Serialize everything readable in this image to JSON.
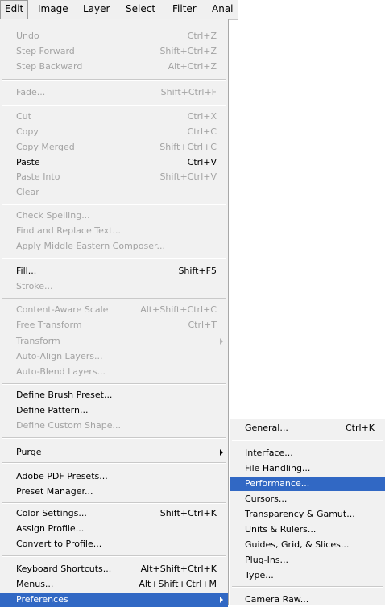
{
  "menubar": {
    "items": [
      "Edit",
      "Image",
      "Layer",
      "Select",
      "Filter",
      "Anal"
    ]
  },
  "edit_menu": {
    "undo": {
      "label": "Undo",
      "shortcut": "Ctrl+Z"
    },
    "step_forward": {
      "label": "Step Forward",
      "shortcut": "Shift+Ctrl+Z"
    },
    "step_backward": {
      "label": "Step Backward",
      "shortcut": "Alt+Ctrl+Z"
    },
    "fade": {
      "label": "Fade...",
      "shortcut": "Shift+Ctrl+F"
    },
    "cut": {
      "label": "Cut",
      "shortcut": "Ctrl+X"
    },
    "copy": {
      "label": "Copy",
      "shortcut": "Ctrl+C"
    },
    "copy_merged": {
      "label": "Copy Merged",
      "shortcut": "Shift+Ctrl+C"
    },
    "paste": {
      "label": "Paste",
      "shortcut": "Ctrl+V"
    },
    "paste_into": {
      "label": "Paste Into",
      "shortcut": "Shift+Ctrl+V"
    },
    "clear": {
      "label": "Clear"
    },
    "check_spelling": {
      "label": "Check Spelling..."
    },
    "find_replace": {
      "label": "Find and Replace Text..."
    },
    "apply_middle_eastern": {
      "label": "Apply Middle Eastern Composer..."
    },
    "fill": {
      "label": "Fill...",
      "shortcut": "Shift+F5"
    },
    "stroke": {
      "label": "Stroke..."
    },
    "content_aware_scale": {
      "label": "Content-Aware Scale",
      "shortcut": "Alt+Shift+Ctrl+C"
    },
    "free_transform": {
      "label": "Free Transform",
      "shortcut": "Ctrl+T"
    },
    "transform": {
      "label": "Transform"
    },
    "auto_align": {
      "label": "Auto-Align Layers..."
    },
    "auto_blend": {
      "label": "Auto-Blend Layers..."
    },
    "define_brush": {
      "label": "Define Brush Preset..."
    },
    "define_pattern": {
      "label": "Define Pattern..."
    },
    "define_shape": {
      "label": "Define Custom Shape..."
    },
    "purge": {
      "label": "Purge"
    },
    "adobe_pdf_presets": {
      "label": "Adobe PDF Presets..."
    },
    "preset_manager": {
      "label": "Preset Manager..."
    },
    "color_settings": {
      "label": "Color Settings...",
      "shortcut": "Shift+Ctrl+K"
    },
    "assign_profile": {
      "label": "Assign Profile..."
    },
    "convert_profile": {
      "label": "Convert to Profile..."
    },
    "keyboard_shortcuts": {
      "label": "Keyboard Shortcuts...",
      "shortcut": "Alt+Shift+Ctrl+K"
    },
    "menus": {
      "label": "Menus...",
      "shortcut": "Alt+Shift+Ctrl+M"
    },
    "preferences": {
      "label": "Preferences"
    }
  },
  "preferences_submenu": {
    "general": {
      "label": "General...",
      "shortcut": "Ctrl+K"
    },
    "interface": {
      "label": "Interface..."
    },
    "file_handling": {
      "label": "File Handling..."
    },
    "performance": {
      "label": "Performance..."
    },
    "cursors": {
      "label": "Cursors..."
    },
    "transparency": {
      "label": "Transparency & Gamut..."
    },
    "units_rulers": {
      "label": "Units & Rulers..."
    },
    "guides": {
      "label": "Guides, Grid, & Slices..."
    },
    "plugins": {
      "label": "Plug-Ins..."
    },
    "type": {
      "label": "Type..."
    },
    "camera_raw": {
      "label": "Camera Raw..."
    }
  },
  "colors": {
    "highlight": "#3168c4",
    "disabled_text": "#a3a3a3",
    "menu_bg": "#f1f1f1"
  }
}
